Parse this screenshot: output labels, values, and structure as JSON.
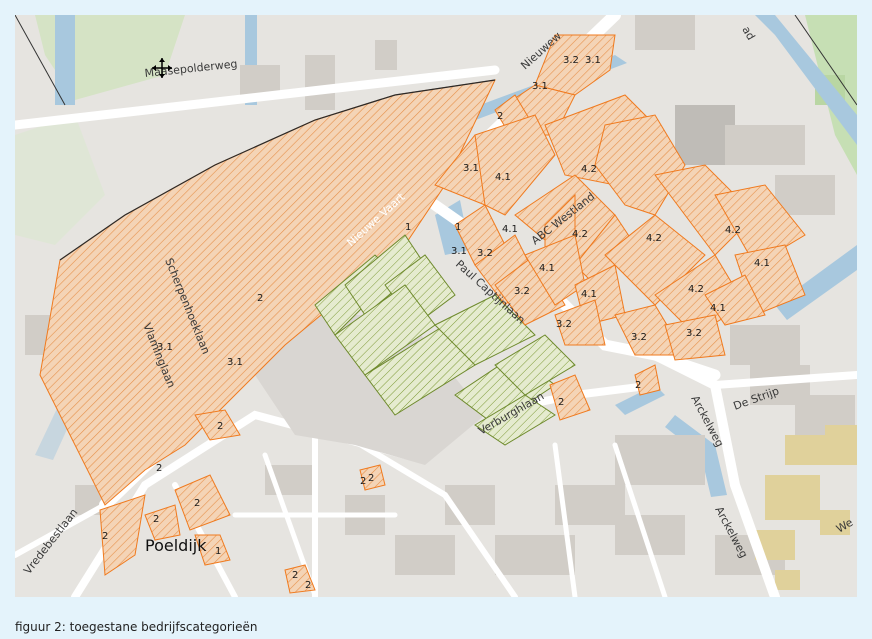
{
  "caption": "figuur 2: toegestane bedrijfscategorieën",
  "colors": {
    "page_bg": "#e4f3fb",
    "base": "#e6e4e0",
    "water": "#a8c8de",
    "road": "#ffffff",
    "building": "#d1cdc7",
    "green": "#c6dfb4",
    "zone_fill": "#f4d4b6",
    "zone_line": "#f07a1e",
    "olive_fill": "#e5ebcf",
    "olive_line": "#6e8a2c",
    "tan": "#e0d19b"
  },
  "icons": {
    "cursor": "move-cursor-icon"
  },
  "town": "Poeldijk",
  "canal": "Nieuwe Vaart",
  "streets": {
    "maasepolderweg": "Maasepolderweg",
    "nieuweweg": "Nieuwew",
    "scherpenhoeklaan": "Scherpenhoeklaan",
    "vlaminglaan": "Vlaminglaan",
    "paul_captijnlaan": "Paul Captijnlaan",
    "abc_westland": "ABC Westland",
    "verburghlaan": "Verburghlaan",
    "arckelweg": "Arckelweg",
    "arckelweg_2": "Arckelweg",
    "de_strijp": "De Strijp",
    "vredebestlaan": "Vredebestlaan",
    "ad": "ad",
    "we": "We"
  },
  "categories": {
    "c3_1_big": "3.1",
    "c2_big": "2",
    "c3_1_vlaming": "3.1",
    "c3_1_canal": "3.1",
    "c1_canal": "1",
    "c3_2_top": "3.2",
    "c3_1_top": "3.1",
    "c3_1_top2": "3.1",
    "c2_top": "2",
    "c3_1_a": "3.1",
    "c4_1_a": "4.1",
    "c4_2_a": "4.2",
    "c1_a": "1",
    "c3_1_b": "3.1",
    "c3_2_a": "3.2",
    "c4_1_b": "4.1",
    "c4_2_b": "4.2",
    "c4_1_c": "4.1",
    "c3_2_b": "3.2",
    "c4_1_d": "4.1",
    "c3_2_c": "3.2",
    "c4_2_c": "4.2",
    "c4_2_d": "4.2",
    "c4_1_e": "4.1",
    "c4_2_e": "4.2",
    "c4_1_f": "4.1",
    "c3_2_d": "3.2",
    "c3_2_e": "3.2",
    "c2_e": "2",
    "c2_f": "2",
    "c2_g": "2",
    "c2_h": "2",
    "c2_i": "2",
    "c2_j": "2",
    "c2_k": "2",
    "c2_l": "2",
    "c2_m": "2",
    "c1_b": "1",
    "c2_n": "2",
    "c2_o": "2"
  }
}
